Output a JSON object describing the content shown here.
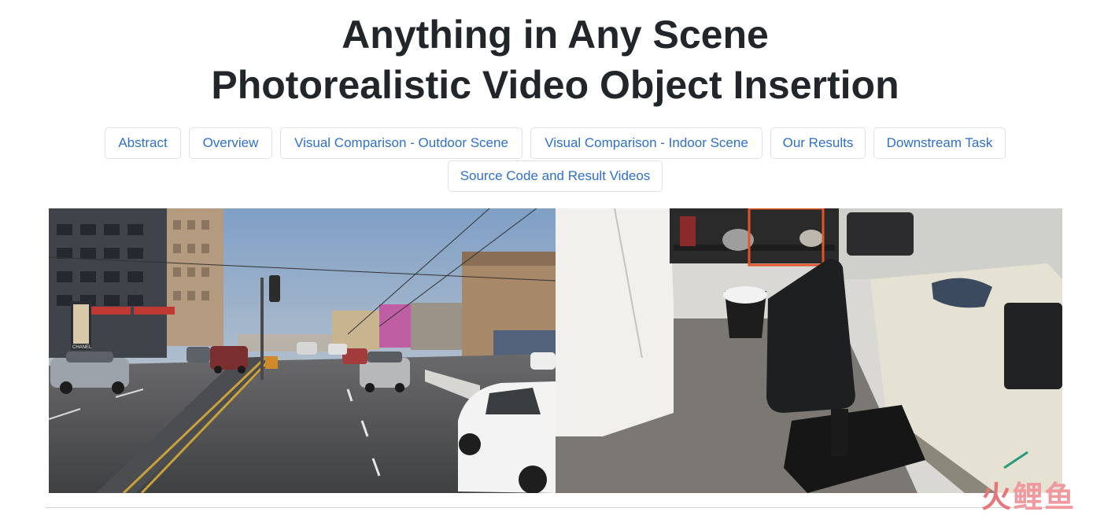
{
  "header": {
    "title_line1": "Anything in Any Scene",
    "title_line2": "Photorealistic Video Object Insertion"
  },
  "nav": {
    "items": [
      {
        "label": "Abstract"
      },
      {
        "label": "Overview"
      },
      {
        "label": "Visual Comparison - Outdoor Scene"
      },
      {
        "label": "Visual Comparison - Indoor Scene"
      },
      {
        "label": "Our Results"
      },
      {
        "label": "Downstream Task"
      },
      {
        "label": "Source Code and Result Videos"
      }
    ]
  },
  "media": {
    "outdoor_storefront_text": "CHANEL"
  },
  "watermark": {
    "char1": "火",
    "char2": "鲤",
    "char3": "鱼"
  },
  "colors": {
    "link": "#2f6fd0",
    "button_border": "#dee2e6",
    "highlight_box": "#e0542a"
  }
}
